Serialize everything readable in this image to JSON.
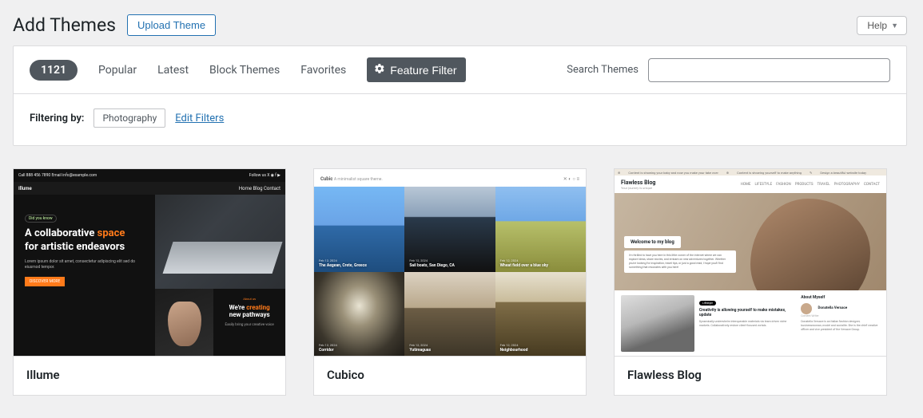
{
  "header": {
    "title": "Add Themes",
    "upload_label": "Upload Theme",
    "help_label": "Help"
  },
  "filter_bar": {
    "count": "1121",
    "links": [
      "Popular",
      "Latest",
      "Block Themes",
      "Favorites"
    ],
    "feature_filter": "Feature Filter",
    "search_label": "Search Themes",
    "search_value": ""
  },
  "filtering": {
    "label": "Filtering by:",
    "tag": "Photography",
    "edit_label": "Edit Filters"
  },
  "themes": [
    {
      "name": "Illume",
      "shot": {
        "topbar_left": "Call 888 456 7890   Email info@example.com",
        "topbar_right": "Follow us   X  ◉  f  ▶",
        "brand": "Illume",
        "nav": "Home   Blog   Contact",
        "chip": "Did you know",
        "headline_a": "A collaborative ",
        "headline_b": "space",
        "headline_c": "for artistic endeavors",
        "para": "Lorem ipsum dolor sit amet, consectetur adipiscing elit sed do eiusmod tempor.",
        "cta": "DISCOVER MORE",
        "side_chip": "About us",
        "side_a": "We're ",
        "side_b": "creating",
        "side_c": "new pathways",
        "side_sub": "Easily bring your creative voice"
      }
    },
    {
      "name": "Cubico",
      "shot": {
        "brand": "Cubic",
        "tagline": "A minimalist square theme.",
        "cells": [
          {
            "date": "Feb 12, 2024",
            "title": "The Aegean, Crete, Greece"
          },
          {
            "date": "Feb 12, 2024",
            "title": "Sail boats, San Diego, CA"
          },
          {
            "date": "Feb 12, 2024",
            "title": "Wheat field over a blue sky"
          },
          {
            "date": "Feb 12, 2024",
            "title": "Corridor"
          },
          {
            "date": "Feb 12, 2024",
            "title": "Yutimaguas"
          },
          {
            "date": "Feb 12, 2024",
            "title": "Neighbourhood"
          }
        ]
      }
    },
    {
      "name": "Flawless Blog",
      "shot": {
        "admin_a": "Content is showing your baby and now you make your take over",
        "admin_b": "Content is showing yourself to make anything",
        "admin_c": "Design a beautiful website today",
        "brand": "Flawless Blog",
        "sub": "Your journey is unique",
        "nav": [
          "HOME",
          "LIFESTYLE",
          "FASHION",
          "PRODUCTS",
          "TRAVEL",
          "PHOTOGRAPHY",
          "CONTACT"
        ],
        "hero_tag": "Welcome to my blog",
        "hero_text": "I'm thrilled to have you here in this little corner of the internet where we can explore ideas, share stories, and embark on new adventures together. Whether you're looking for inspiration, travel tips, or just a good read, I hope you'll find something that resonates with you here!",
        "article_pill": "Lifestyle",
        "article_title": "Creativity is allowing yourself to make mistakes, update",
        "article_text": "Dynamically underwhelm interoperable materials via team driven niche markets. Collaboratively restore client-focused vortals.",
        "aside_h": "About Myself",
        "aside_name": "Donatella Versace",
        "aside_role": "Content Writer",
        "aside_bio": "Donatella Versace is an Italian fashion designer, businesswoman, model and socialite. She is the chief creative officer and vice president of the Versace Group."
      }
    }
  ]
}
